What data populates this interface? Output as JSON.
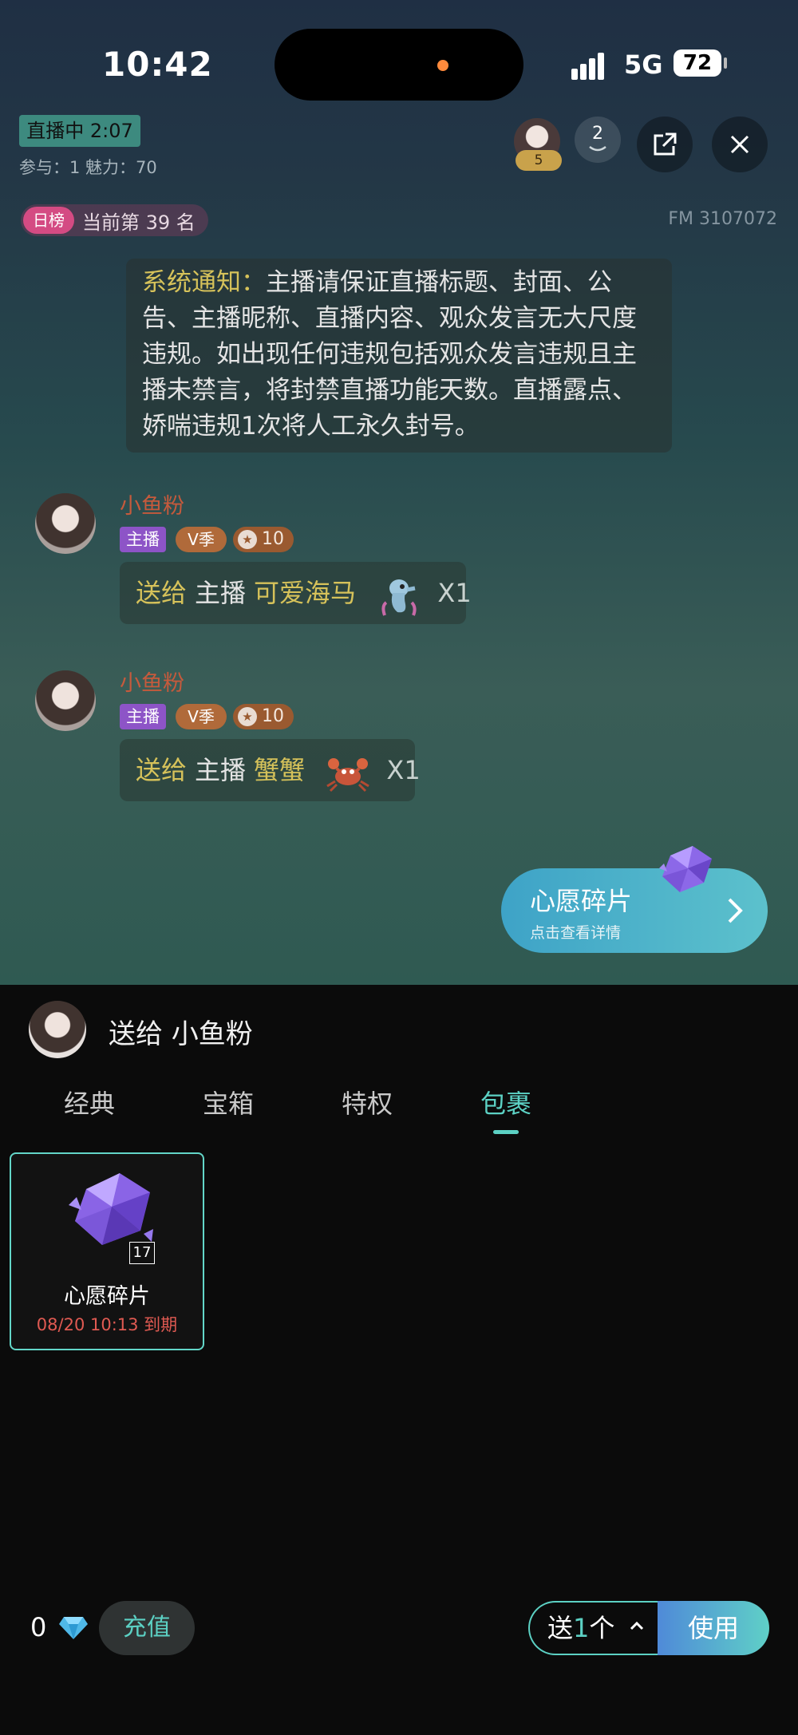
{
  "status_bar": {
    "time": "10:42",
    "network": "5G",
    "battery": "72"
  },
  "live": {
    "status_label": "直播中 2:07",
    "stats": "参与：1 魅力：70",
    "host_level": "5",
    "viewer_count": "2",
    "rank_tag": "日榜",
    "rank_text": "当前第 39 名",
    "fm_id": "FM 3107072"
  },
  "notice": {
    "label": "系统通知：",
    "text": "主播请保证直播标题、封面、公告、主播昵称、直播内容、观众发言无大尺度违规。如出现任何违规包括观众发言违规且主播未禁言，将封禁直播功能天数。直播露点、娇喘违规1次将人工永久封号。"
  },
  "messages": [
    {
      "name": "小鱼粉",
      "badge_host": "主播",
      "badge_v": "V季",
      "badge_star_level": "10",
      "send_label": "送给",
      "recipient": "主播",
      "gift_name": "可爱海马",
      "gift_icon": "seahorse-icon",
      "count": "X1"
    },
    {
      "name": "小鱼粉",
      "badge_host": "主播",
      "badge_v": "V季",
      "badge_star_level": "10",
      "send_label": "送给",
      "recipient": "主播",
      "gift_name": "蟹蟹",
      "gift_icon": "crab-icon",
      "count": "X1"
    }
  ],
  "wish_banner": {
    "title": "心愿碎片",
    "subtitle": "点击查看详情"
  },
  "gift_panel": {
    "send_to": "送给 小鱼粉",
    "tabs": [
      "经典",
      "宝箱",
      "特权",
      "包裹"
    ],
    "active_tab": "包裹",
    "items": [
      {
        "name": "心愿碎片",
        "count": "17",
        "expiry": "08/20 10:13 到期"
      }
    ],
    "diamond_balance": "0",
    "recharge_label": "充值",
    "send_prefix": "送",
    "send_quantity": "1",
    "send_suffix": "个",
    "use_label": "使用"
  },
  "colors": {
    "accent": "#5cd1c4",
    "gold_text": "#d6c25a",
    "rank_pink": "#d44b83",
    "expiry_red": "#e05a52"
  }
}
